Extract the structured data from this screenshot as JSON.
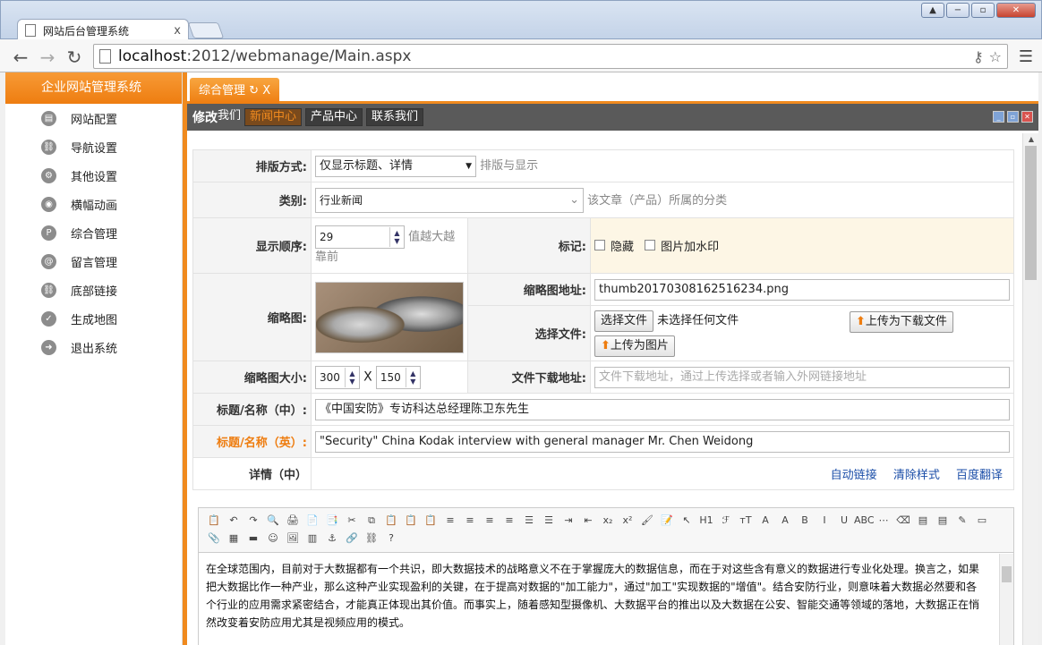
{
  "browser": {
    "tab_title": "网站后台管理系统",
    "tab_close": "x",
    "url_host": "localhost",
    "url_rest": ":2012/webmanage/Main.aspx",
    "window_buttons": [
      "▲",
      "−",
      "▫",
      "✕"
    ]
  },
  "sidebar": {
    "title": "企业网站管理系统",
    "items": [
      {
        "label": "网站配置"
      },
      {
        "label": "导航设置"
      },
      {
        "label": "其他设置"
      },
      {
        "label": "横幅动画"
      },
      {
        "label": "综合管理",
        "icon_text": "P"
      },
      {
        "label": "留言管理",
        "icon_text": "@"
      },
      {
        "label": "底部链接"
      },
      {
        "label": "生成地图"
      },
      {
        "label": "退出系统"
      }
    ]
  },
  "main_tab": {
    "label": "综合管理",
    "refresh": "↻",
    "close": "X"
  },
  "panel": {
    "caption": "修改",
    "tabs": [
      "我们",
      "新闻中心",
      "产品中心",
      "联系我们"
    ]
  },
  "form": {
    "layout_label": "排版方式:",
    "layout_value": "仅显示标题、详情",
    "layout_hint": "排版与显示",
    "category_label": "类别:",
    "category_value": "行业新闻",
    "category_hint": "该文章（产品）所属的分类",
    "order_label": "显示顺序:",
    "order_value": "29",
    "order_hint1": "值越大越",
    "order_hint2": "靠前",
    "mark_label": "标记:",
    "mark_hide": "隐藏",
    "mark_watermark": "图片加水印",
    "thumb_label": "缩略图:",
    "thumb_url_label": "缩略图地址:",
    "thumb_url_value": "thumb20170308162516234.png",
    "choose_file_label": "选择文件:",
    "choose_file_btn": "选择文件",
    "no_file_text": "未选择任何文件",
    "upload_download_btn": "上传为下载文件",
    "upload_image_btn": "上传为图片",
    "thumb_size_label": "缩略图大小:",
    "thumb_w": "300",
    "thumb_x": "X",
    "thumb_h": "150",
    "download_label": "文件下载地址:",
    "download_placeholder": "文件下载地址，通过上传选择或者输入外网链接地址",
    "title_cn_label": "标题/名称（中）:",
    "title_cn_value": "《中国安防》专访科达总经理陈卫东先生",
    "title_en_label": "标题/名称（英）:",
    "title_en_value": "\"Security\" China Kodak interview with general manager Mr. Chen Weidong",
    "detail_label": "详情（中）",
    "link_auto": "自动链接",
    "link_clear": "清除样式",
    "link_translate": "百度翻译"
  },
  "editor": {
    "toolbar": [
      "📋",
      "↶",
      "↷",
      "🔍",
      "🖨",
      "📄",
      "📑",
      "✂",
      "⧉",
      "📋",
      "📋",
      "📋",
      "≡",
      "≡",
      "≡",
      "≡",
      "☰",
      "☰",
      "⇥",
      "⇤",
      "x₂",
      "x²",
      "🖌",
      "📝",
      "↖",
      "H1",
      "ℱ",
      "тT",
      "A",
      "A",
      "B",
      "I",
      "U",
      "ABC",
      "⋯",
      "⌫",
      "▤",
      "▤",
      "✎",
      "▭",
      "📎",
      "▦",
      "▬",
      "☺",
      "🖼",
      "▥",
      "⚓",
      "🔗",
      "⛓",
      "?"
    ],
    "body": "在全球范围内，目前对于大数据都有一个共识，即大数据技术的战略意义不在于掌握庞大的数据信息，而在于对这些含有意义的数据进行专业化处理。换言之，如果把大数据比作一种产业，那么这种产业实现盈利的关键，在于提高对数据的\"加工能力\"，通过\"加工\"实现数据的\"增值\"。结合安防行业，则意味着大数据必然要和各个行业的应用需求紧密结合，才能真正体现出其价值。而事实上，随着感知型摄像机、大数据平台的推出以及大数据在公安、智能交通等领域的落地，大数据正在悄然改变着安防应用尤其是视频应用的模式。"
  }
}
